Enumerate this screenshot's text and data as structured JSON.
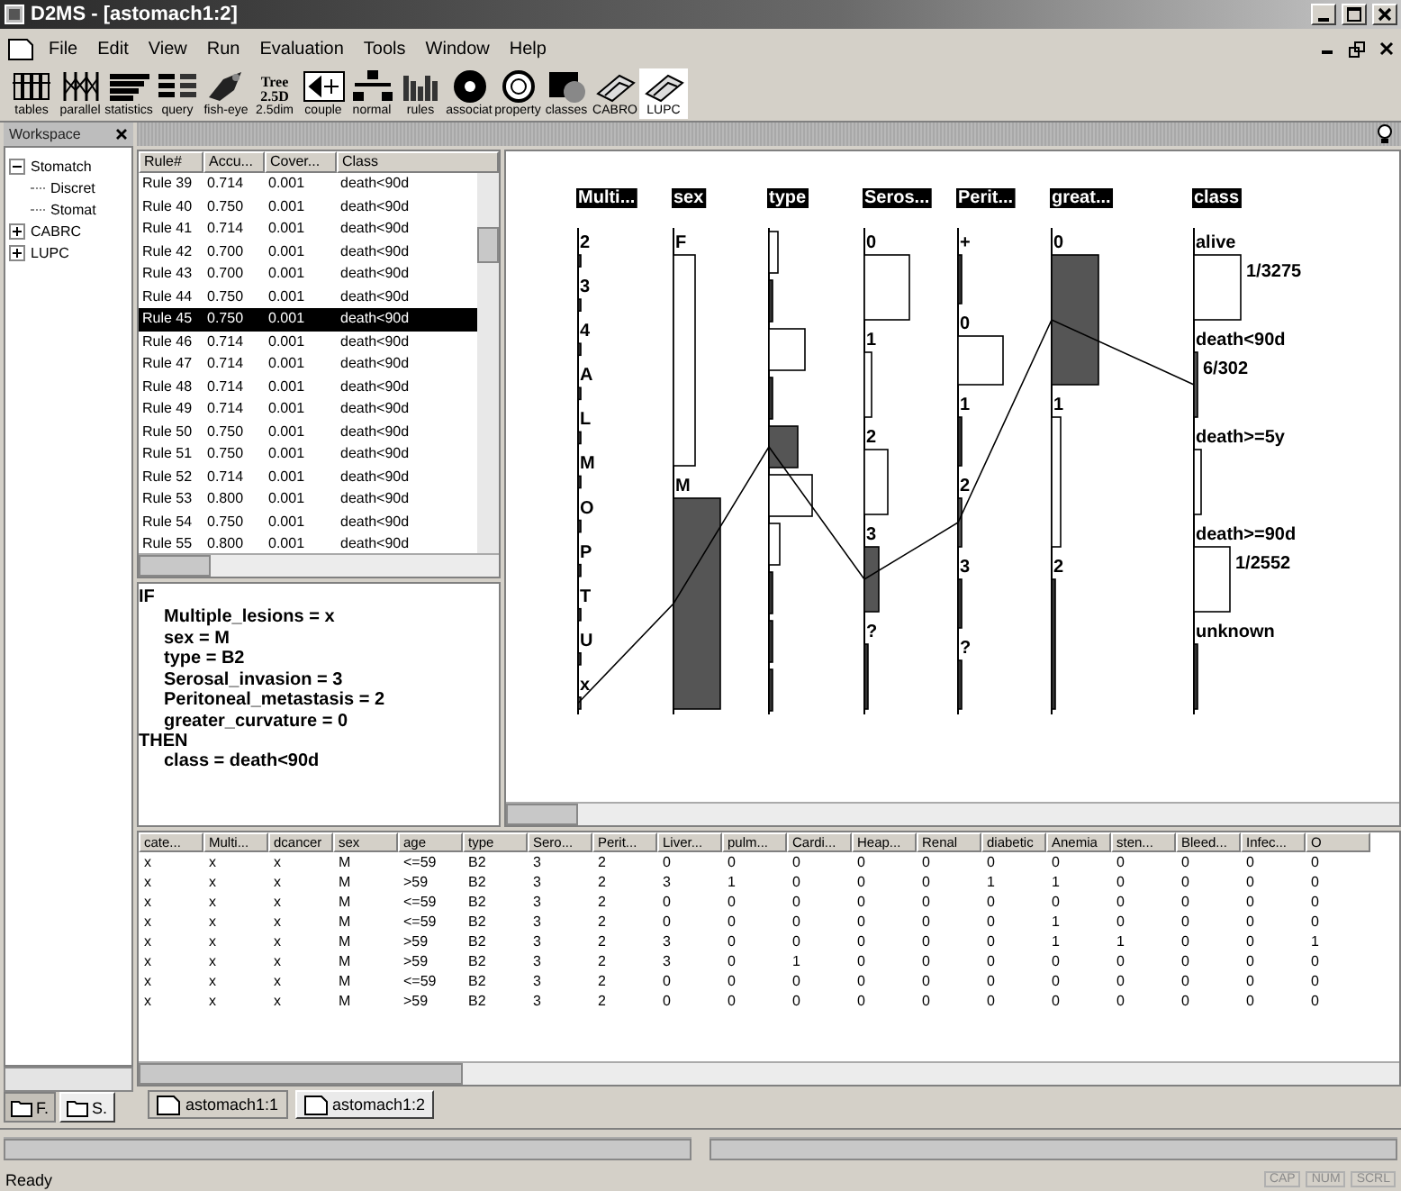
{
  "window": {
    "title": "D2MS - [astomach1:2]"
  },
  "menu": [
    "File",
    "Edit",
    "View",
    "Run",
    "Evaluation",
    "Tools",
    "Window",
    "Help"
  ],
  "toolbar": [
    {
      "label": "tables",
      "kind": "glyph"
    },
    {
      "label": "parallel",
      "kind": "glyph"
    },
    {
      "label": "statistics",
      "kind": "glyph"
    },
    {
      "label": "query",
      "kind": "glyph"
    },
    {
      "label": "fish-eye",
      "kind": "glyph"
    },
    {
      "label": "2.5dim",
      "kind": "text",
      "icon_text": [
        "Tree",
        "2.5D"
      ]
    },
    {
      "label": "couple",
      "kind": "glyph"
    },
    {
      "label": "normal",
      "kind": "glyph"
    },
    {
      "label": "rules",
      "kind": "glyph"
    },
    {
      "label": "associat",
      "kind": "glyph"
    },
    {
      "label": "property",
      "kind": "glyph"
    },
    {
      "label": "classes",
      "kind": "glyph"
    },
    {
      "label": "CABRO",
      "kind": "glyph"
    },
    {
      "label": "LUPC",
      "kind": "glyph"
    }
  ],
  "workspace": {
    "title": "Workspace",
    "tree": [
      {
        "label": "Stomatch",
        "expanded": true,
        "children": [
          {
            "label": "Discret"
          },
          {
            "label": "Stomat"
          }
        ]
      },
      {
        "label": "CABRC",
        "expanded": false
      },
      {
        "label": "LUPC",
        "expanded": false
      }
    ],
    "tabs": [
      {
        "label": "F.",
        "selected": false
      },
      {
        "label": "S.",
        "selected": true
      }
    ]
  },
  "rules": {
    "columns": [
      "Rule#",
      "Accu...",
      "Cover...",
      "Class"
    ],
    "rows": [
      {
        "cells": [
          "Rule 39",
          "0.714",
          "0.001",
          "death<90d"
        ],
        "selected": false
      },
      {
        "cells": [
          "Rule 40",
          "0.750",
          "0.001",
          "death<90d"
        ],
        "selected": false
      },
      {
        "cells": [
          "Rule 41",
          "0.714",
          "0.001",
          "death<90d"
        ],
        "selected": false
      },
      {
        "cells": [
          "Rule 42",
          "0.700",
          "0.001",
          "death<90d"
        ],
        "selected": false
      },
      {
        "cells": [
          "Rule 43",
          "0.700",
          "0.001",
          "death<90d"
        ],
        "selected": false
      },
      {
        "cells": [
          "Rule 44",
          "0.750",
          "0.001",
          "death<90d"
        ],
        "selected": false
      },
      {
        "cells": [
          "Rule 45",
          "0.750",
          "0.001",
          "death<90d"
        ],
        "selected": true
      },
      {
        "cells": [
          "Rule 46",
          "0.714",
          "0.001",
          "death<90d"
        ],
        "selected": false
      },
      {
        "cells": [
          "Rule 47",
          "0.714",
          "0.001",
          "death<90d"
        ],
        "selected": false
      },
      {
        "cells": [
          "Rule 48",
          "0.714",
          "0.001",
          "death<90d"
        ],
        "selected": false
      },
      {
        "cells": [
          "Rule 49",
          "0.714",
          "0.001",
          "death<90d"
        ],
        "selected": false
      },
      {
        "cells": [
          "Rule 50",
          "0.750",
          "0.001",
          "death<90d"
        ],
        "selected": false
      },
      {
        "cells": [
          "Rule 51",
          "0.750",
          "0.001",
          "death<90d"
        ],
        "selected": false
      },
      {
        "cells": [
          "Rule 52",
          "0.714",
          "0.001",
          "death<90d"
        ],
        "selected": false
      },
      {
        "cells": [
          "Rule 53",
          "0.800",
          "0.001",
          "death<90d"
        ],
        "selected": false
      },
      {
        "cells": [
          "Rule 54",
          "0.750",
          "0.001",
          "death<90d"
        ],
        "selected": false
      },
      {
        "cells": [
          "Rule 55",
          "0.800",
          "0.001",
          "death<90d"
        ],
        "selected": false
      }
    ]
  },
  "rule_text": [
    {
      "kind": "keyword",
      "text": "IF"
    },
    {
      "kind": "clause",
      "text": "Multiple_lesions = x"
    },
    {
      "kind": "clause",
      "text": "sex = M"
    },
    {
      "kind": "clause",
      "text": "type = B2"
    },
    {
      "kind": "clause",
      "text": "Serosal_invasion = 3"
    },
    {
      "kind": "clause",
      "text": "Peritoneal_metastasis = 2"
    },
    {
      "kind": "clause",
      "text": "greater_curvature = 0"
    },
    {
      "kind": "keyword",
      "text": "THEN"
    },
    {
      "kind": "clause",
      "text": "class = death<90d"
    }
  ],
  "chart": {
    "axes": [
      {
        "name": "Multi...",
        "values": [
          {
            "label": "2",
            "selected": false
          },
          {
            "label": "3",
            "selected": false
          },
          {
            "label": "4",
            "selected": false
          },
          {
            "label": "A",
            "selected": false
          },
          {
            "label": "L",
            "selected": false
          },
          {
            "label": "M",
            "selected": false
          },
          {
            "label": "O",
            "selected": false
          },
          {
            "label": "P",
            "selected": false
          },
          {
            "label": "T",
            "selected": false
          },
          {
            "label": "U",
            "selected": false
          },
          {
            "label": "x",
            "selected": true
          }
        ]
      },
      {
        "name": "sex",
        "values": [
          {
            "label": "F",
            "selected": false
          },
          {
            "label": "M",
            "selected": true
          }
        ]
      },
      {
        "name": "type",
        "values": [
          {
            "selected": false
          },
          {
            "selected": false
          },
          {
            "selected": false
          },
          {
            "selected": false
          },
          {
            "selected": true
          },
          {
            "selected": false
          },
          {
            "selected": false
          },
          {
            "selected": false
          },
          {
            "selected": false
          },
          {
            "selected": false
          }
        ]
      },
      {
        "name": "Seros...",
        "values": [
          {
            "label": "0",
            "selected": false
          },
          {
            "label": "1",
            "selected": false
          },
          {
            "label": "2",
            "selected": false
          },
          {
            "label": "3",
            "selected": true
          },
          {
            "label": "?",
            "selected": false
          }
        ]
      },
      {
        "name": "Perit...",
        "values": [
          {
            "label": "+",
            "selected": false
          },
          {
            "label": "0",
            "selected": false
          },
          {
            "label": "1",
            "selected": false
          },
          {
            "label": "2",
            "selected": true
          },
          {
            "label": "3",
            "selected": false
          },
          {
            "label": "?",
            "selected": false
          }
        ]
      },
      {
        "name": "great...",
        "values": [
          {
            "label": "0",
            "selected": true
          },
          {
            "label": "1",
            "selected": false
          },
          {
            "label": "2",
            "selected": false
          }
        ]
      },
      {
        "name": "class",
        "values": [
          {
            "label": "alive",
            "selected": false,
            "count": "1/3275"
          },
          {
            "label": "death<90d",
            "selected": true,
            "count": "6/302"
          },
          {
            "label": "death>=5y",
            "selected": false
          },
          {
            "label": "death>=90d",
            "selected": false,
            "count": "1/2552"
          },
          {
            "label": "unknown",
            "selected": false
          }
        ]
      }
    ]
  },
  "table": {
    "columns": [
      "cate...",
      "Multi...",
      "dcancer",
      "sex",
      "age",
      "type",
      "Sero...",
      "Perit...",
      "Liver...",
      "pulm...",
      "Cardi...",
      "Heap...",
      "Renal",
      "diabetic",
      "Anemia",
      "sten...",
      "Bleed...",
      "Infec...",
      "O"
    ],
    "rows": [
      [
        "x",
        "x",
        "x",
        "M",
        "<=59",
        "B2",
        "3",
        "2",
        "0",
        "0",
        "0",
        "0",
        "0",
        "0",
        "0",
        "0",
        "0",
        "0",
        "0"
      ],
      [
        "x",
        "x",
        "x",
        "M",
        ">59",
        "B2",
        "3",
        "2",
        "3",
        "1",
        "0",
        "0",
        "0",
        "1",
        "1",
        "0",
        "0",
        "0",
        "0"
      ],
      [
        "x",
        "x",
        "x",
        "M",
        "<=59",
        "B2",
        "3",
        "2",
        "0",
        "0",
        "0",
        "0",
        "0",
        "0",
        "0",
        "0",
        "0",
        "0",
        "0"
      ],
      [
        "x",
        "x",
        "x",
        "M",
        "<=59",
        "B2",
        "3",
        "2",
        "0",
        "0",
        "0",
        "0",
        "0",
        "0",
        "1",
        "0",
        "0",
        "0",
        "0"
      ],
      [
        "x",
        "x",
        "x",
        "M",
        ">59",
        "B2",
        "3",
        "2",
        "3",
        "0",
        "0",
        "0",
        "0",
        "0",
        "1",
        "1",
        "0",
        "0",
        "1"
      ],
      [
        "x",
        "x",
        "x",
        "M",
        ">59",
        "B2",
        "3",
        "2",
        "3",
        "0",
        "1",
        "0",
        "0",
        "0",
        "0",
        "0",
        "0",
        "0",
        "0"
      ],
      [
        "x",
        "x",
        "x",
        "M",
        "<=59",
        "B2",
        "3",
        "2",
        "0",
        "0",
        "0",
        "0",
        "0",
        "0",
        "0",
        "0",
        "0",
        "0",
        "0"
      ],
      [
        "x",
        "x",
        "x",
        "M",
        ">59",
        "B2",
        "3",
        "2",
        "0",
        "0",
        "0",
        "0",
        "0",
        "0",
        "0",
        "0",
        "0",
        "0",
        "0"
      ]
    ]
  },
  "documents": [
    {
      "label": "astomach1:1",
      "selected": false
    },
    {
      "label": "astomach1:2",
      "selected": true
    }
  ],
  "status": {
    "text": "Ready",
    "indicators": [
      "CAP",
      "NUM",
      "SCRL"
    ]
  }
}
